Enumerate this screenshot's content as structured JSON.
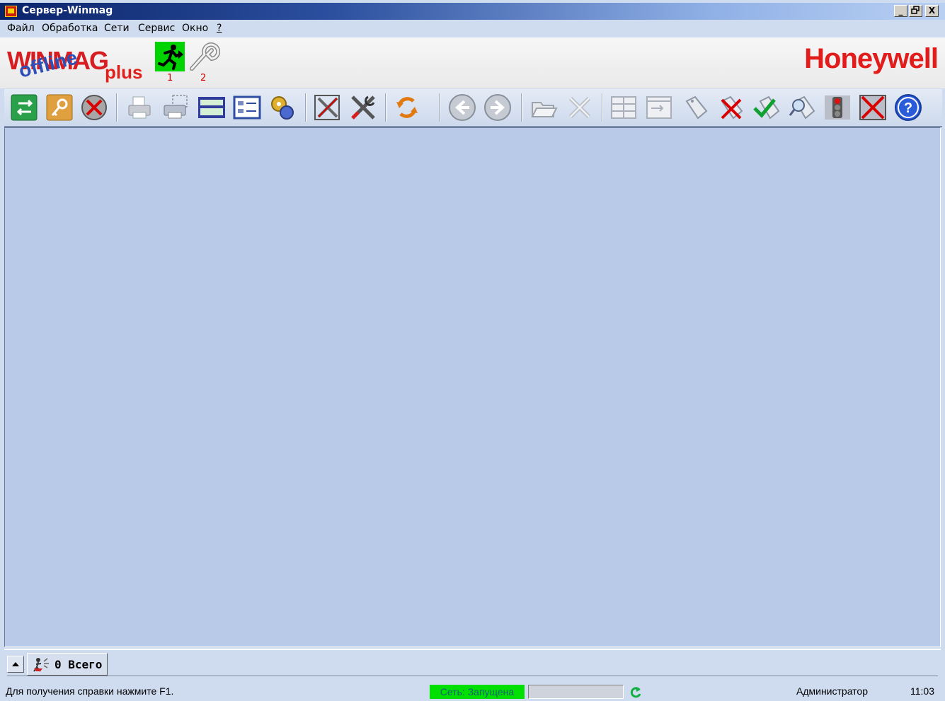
{
  "window": {
    "title": "Сервер-Winmag",
    "controls": {
      "minimize": "_",
      "restore": "ᗝ",
      "close": "X"
    }
  },
  "menu": [
    {
      "label": "Файл"
    },
    {
      "label": "Обработка"
    },
    {
      "label": "Сети"
    },
    {
      "label": "Сервис"
    },
    {
      "label": "Окно"
    },
    {
      "label": "?"
    }
  ],
  "banner": {
    "logo": {
      "main": "WINMAG",
      "overlay": "offline",
      "suffix": "plus"
    },
    "quick_buttons": [
      {
        "icon": "running-man-icon",
        "label": "1"
      },
      {
        "icon": "wrench-icon",
        "label": "2"
      }
    ],
    "brand": "Honeywell",
    "brand_color": "#e21b1b"
  },
  "toolbar": {
    "buttons": [
      "switch-icon",
      "key-icon",
      "cancel-icon",
      "print-icon",
      "print-selection-icon",
      "keyboard-icon",
      "list-view-icon",
      "gears-icon",
      "disable-tools-icon",
      "tools-icon",
      "refresh-icon",
      "back-icon",
      "forward-icon",
      "open-folder-icon",
      "close-x-icon",
      "grid-view-icon",
      "form-view-icon",
      "tag-icon",
      "tag-delete-icon",
      "tag-check-icon",
      "tag-search-icon",
      "traffic-light-icon",
      "stop-box-icon",
      "help-icon"
    ]
  },
  "alarm_bar": {
    "count_label": "0 Всего",
    "icon": "alarm-person-icon"
  },
  "status": {
    "help_text": "Для получения справки нажмите F1.",
    "network": "Сеть: Запущена",
    "network_color": "#00e000",
    "user": "Администратор",
    "time": "11:03",
    "refresh_icon": "refresh-green-icon"
  }
}
